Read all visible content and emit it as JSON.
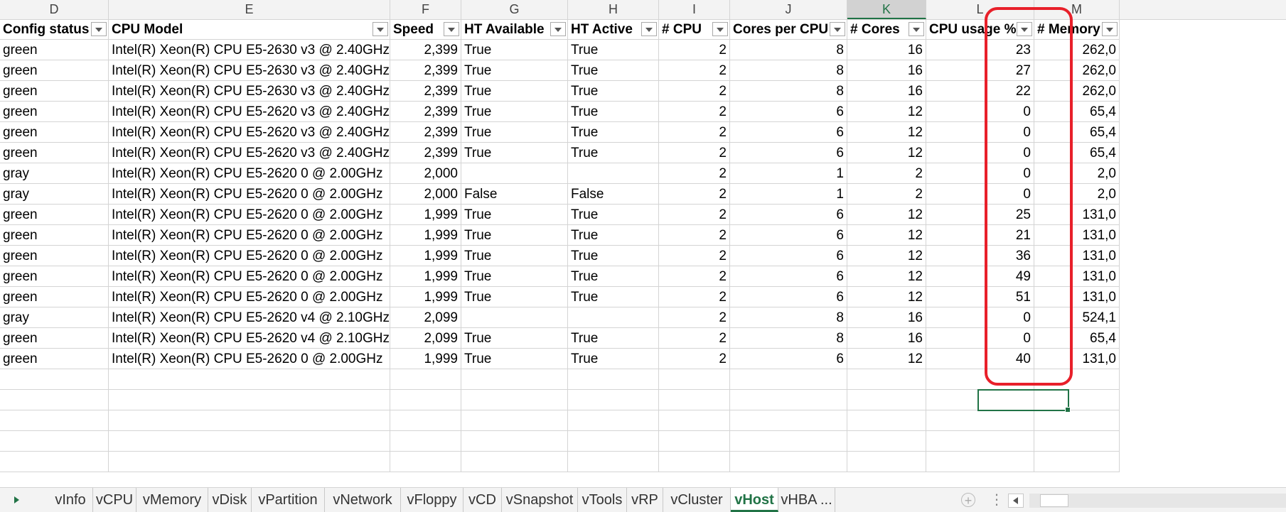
{
  "columns": [
    "D",
    "E",
    "F",
    "G",
    "H",
    "I",
    "J",
    "K",
    "L",
    "M"
  ],
  "headers": [
    "Config status",
    "CPU Model",
    "Speed",
    "HT Available",
    "HT Active",
    "# CPU",
    "Cores per CPU",
    "# Cores",
    "CPU usage %",
    "# Memory"
  ],
  "rows": [
    [
      "green",
      "Intel(R) Xeon(R) CPU E5-2630 v3 @ 2.40GHz",
      "2,399",
      "True",
      "True",
      "2",
      "8",
      "16",
      "23",
      "262,0"
    ],
    [
      "green",
      "Intel(R) Xeon(R) CPU E5-2630 v3 @ 2.40GHz",
      "2,399",
      "True",
      "True",
      "2",
      "8",
      "16",
      "27",
      "262,0"
    ],
    [
      "green",
      "Intel(R) Xeon(R) CPU E5-2630 v3 @ 2.40GHz",
      "2,399",
      "True",
      "True",
      "2",
      "8",
      "16",
      "22",
      "262,0"
    ],
    [
      "green",
      "Intel(R) Xeon(R) CPU E5-2620 v3 @ 2.40GHz",
      "2,399",
      "True",
      "True",
      "2",
      "6",
      "12",
      "0",
      "65,4"
    ],
    [
      "green",
      "Intel(R) Xeon(R) CPU E5-2620 v3 @ 2.40GHz",
      "2,399",
      "True",
      "True",
      "2",
      "6",
      "12",
      "0",
      "65,4"
    ],
    [
      "green",
      "Intel(R) Xeon(R) CPU E5-2620 v3 @ 2.40GHz",
      "2,399",
      "True",
      "True",
      "2",
      "6",
      "12",
      "0",
      "65,4"
    ],
    [
      "gray",
      "Intel(R) Xeon(R) CPU E5-2620 0 @ 2.00GHz",
      "2,000",
      "",
      "",
      "2",
      "1",
      "2",
      "0",
      "2,0"
    ],
    [
      "gray",
      "Intel(R) Xeon(R) CPU E5-2620 0 @ 2.00GHz",
      "2,000",
      "False",
      "False",
      "2",
      "1",
      "2",
      "0",
      "2,0"
    ],
    [
      "green",
      "Intel(R) Xeon(R) CPU E5-2620 0 @ 2.00GHz",
      "1,999",
      "True",
      "True",
      "2",
      "6",
      "12",
      "25",
      "131,0"
    ],
    [
      "green",
      "Intel(R) Xeon(R) CPU E5-2620 0 @ 2.00GHz",
      "1,999",
      "True",
      "True",
      "2",
      "6",
      "12",
      "21",
      "131,0"
    ],
    [
      "green",
      "Intel(R) Xeon(R) CPU E5-2620 0 @ 2.00GHz",
      "1,999",
      "True",
      "True",
      "2",
      "6",
      "12",
      "36",
      "131,0"
    ],
    [
      "green",
      "Intel(R) Xeon(R) CPU E5-2620 0 @ 2.00GHz",
      "1,999",
      "True",
      "True",
      "2",
      "6",
      "12",
      "49",
      "131,0"
    ],
    [
      "green",
      "Intel(R) Xeon(R) CPU E5-2620 0 @ 2.00GHz",
      "1,999",
      "True",
      "True",
      "2",
      "6",
      "12",
      "51",
      "131,0"
    ],
    [
      "gray",
      "Intel(R) Xeon(R) CPU E5-2620 v4 @ 2.10GHz",
      "2,099",
      "",
      "",
      "2",
      "8",
      "16",
      "0",
      "524,1"
    ],
    [
      "green",
      "Intel(R) Xeon(R) CPU E5-2620 v4 @ 2.10GHz",
      "2,099",
      "True",
      "True",
      "2",
      "8",
      "16",
      "0",
      "65,4"
    ],
    [
      "green",
      "Intel(R) Xeon(R) CPU E5-2620 0 @ 2.00GHz",
      "1,999",
      "True",
      "True",
      "2",
      "6",
      "12",
      "40",
      "131,0"
    ]
  ],
  "tabs": [
    "vInfo",
    "vCPU",
    "vMemory",
    "vDisk",
    "vPartition",
    "vNetwork",
    "vFloppy",
    "vCD",
    "vSnapshot",
    "vTools",
    "vRP",
    "vCluster",
    "vHost",
    "vHBA ..."
  ],
  "active_tab": "vHost",
  "selected_column": "K",
  "colors": {
    "accent": "#217346",
    "highlight_outline": "#e8202a"
  }
}
